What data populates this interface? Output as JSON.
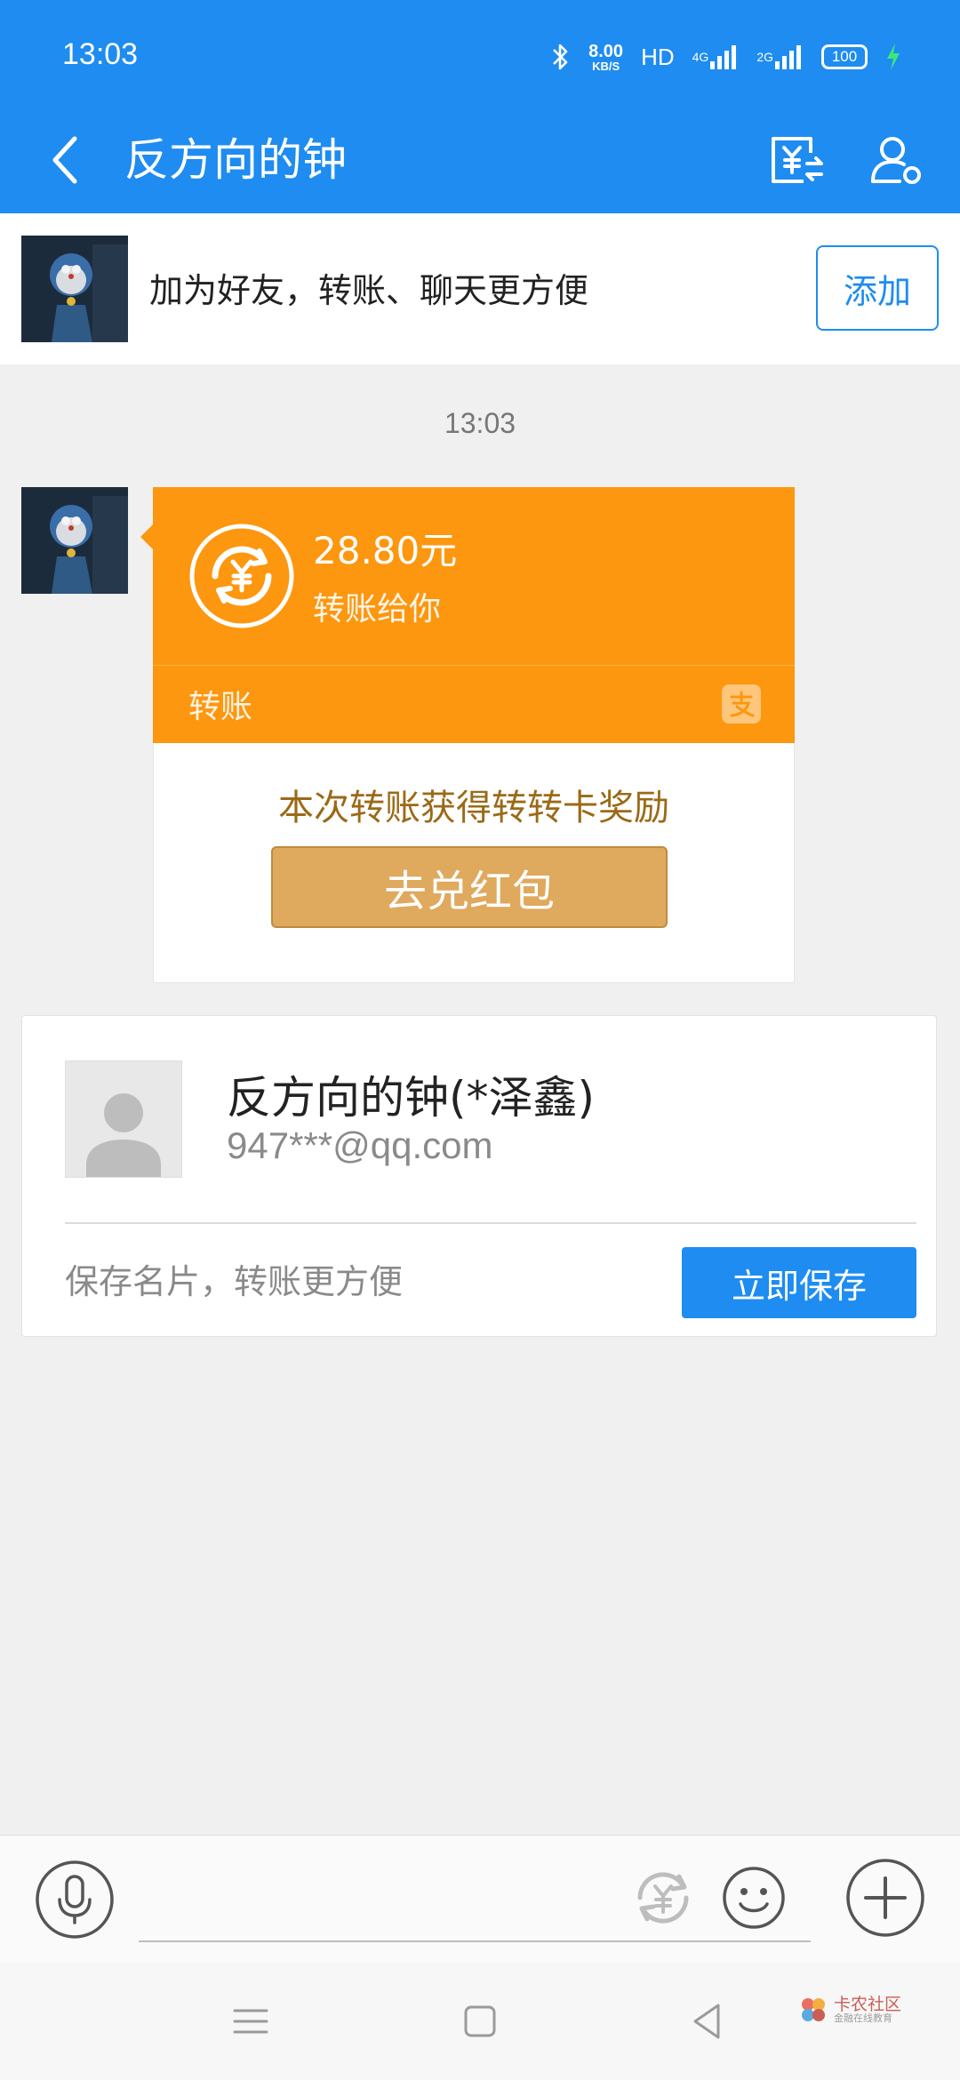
{
  "status_bar": {
    "time": "13:03",
    "net_speed_value": "8.00",
    "net_speed_unit": "KB/S",
    "hd_label": "HD",
    "sim1_label": "4G",
    "sim2_label": "2G",
    "battery_level": "100",
    "icons": [
      "bluetooth-icon",
      "signal-icon",
      "battery-icon",
      "charging-icon"
    ]
  },
  "header": {
    "title": "反方向的钟",
    "back_icon": "chevron-left-icon",
    "transfer_icon": "yuan-transfer-icon",
    "profile_icon": "user-settings-icon"
  },
  "friend_banner": {
    "text": "加为好友，转账、聊天更方便",
    "add_button": "添加"
  },
  "chat": {
    "timestamp": "13:03",
    "transfer": {
      "amount": "28.80元",
      "description": "转账给你",
      "type_label": "转账",
      "reward_text": "本次转账获得转转卡奖励",
      "redeem_button": "去兑红包"
    }
  },
  "save_card": {
    "name": "反方向的钟(*泽鑫)",
    "account": "947***@qq.com",
    "hint": "保存名片，转账更方便",
    "save_button": "立即保存"
  },
  "input_bar": {
    "placeholder": "",
    "icons": [
      "microphone-icon",
      "yuan-transfer-icon",
      "emoji-icon",
      "plus-icon"
    ]
  },
  "nav_bar": {
    "icons": [
      "menu-icon",
      "home-square-icon",
      "back-triangle-icon"
    ],
    "watermark_title": "卡农社区",
    "watermark_subtitle": "金融在线教育"
  },
  "colors": {
    "primary": "#1e8cf0",
    "transfer_orange": "#fd970f",
    "reward_gold": "#dfa95e",
    "reward_text": "#9b6a17",
    "background": "#f0f0f0"
  }
}
